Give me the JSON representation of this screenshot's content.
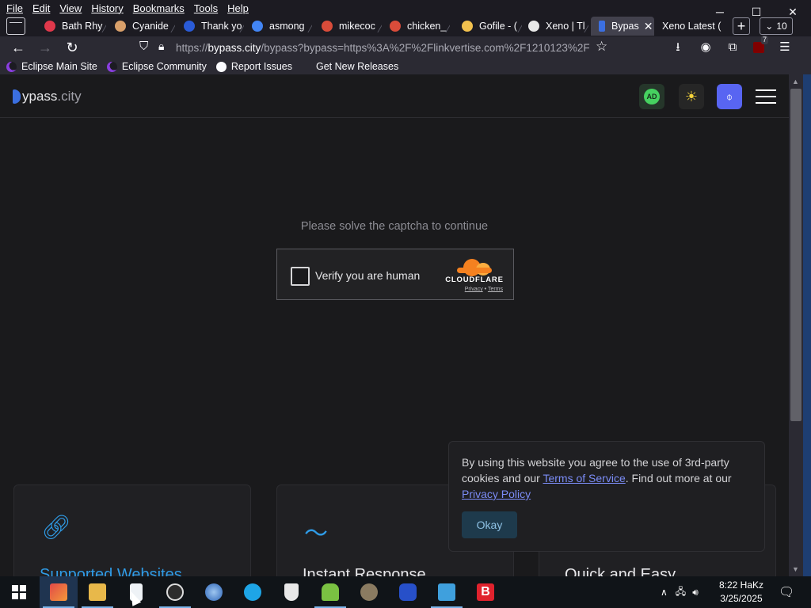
{
  "menu": [
    "File",
    "Edit",
    "View",
    "History",
    "Bookmarks",
    "Tools",
    "Help"
  ],
  "tabs": [
    {
      "label": "Bath Rhy",
      "color": "#e0384b"
    },
    {
      "label": "Cyanide",
      "color": "#d9a06a"
    },
    {
      "label": "Thank yo",
      "color": "#2a5bd7"
    },
    {
      "label": "asmong",
      "color": "#4285f4"
    },
    {
      "label": "mikecoc",
      "color": "#d94c3a"
    },
    {
      "label": "chicken_",
      "color": "#d94c3a"
    },
    {
      "label": "Gofile - (",
      "color": "#f2c14e"
    },
    {
      "label": "Xeno | Tl",
      "color": "#e8e8e8"
    },
    {
      "label": "Bypas",
      "color": "#3b6fe0"
    },
    {
      "label": "Xeno Latest (",
      "color": "#888888"
    }
  ],
  "tab_count": "10",
  "url": {
    "prefix": "https://",
    "host": "bypass.city",
    "rest": "/bypass?bypass=https%3A%2F%2Flinkvertise.com%2F1210123%2F"
  },
  "extension_badge": "7",
  "bookmarks": [
    "Eclipse Main Site",
    "Eclipse Community",
    "Report Issues",
    "Get New Releases"
  ],
  "site": {
    "logo_main": "ypass",
    "logo_tld": ".city",
    "ad_badge": "AD",
    "prompt": "Please solve the captcha to continue",
    "captcha_label": "Verify you are human",
    "captcha_brand": "CLOUDFLARE",
    "captcha_privacy": "Privacy",
    "captcha_dot": "•",
    "captcha_terms": "Terms",
    "cards": [
      "Supported Websites",
      "Instant Response",
      "Quick and Easy"
    ],
    "cookie_text_1": "By using this website you agree to the use of 3rd-party cookies and our ",
    "cookie_tos": "Terms of Service",
    "cookie_text_2": ". Find out more at our ",
    "cookie_privacy": "Privacy Policy",
    "cookie_button": "Okay"
  },
  "clock": {
    "time": "8:22 HaKz",
    "date": "3/25/2025"
  }
}
